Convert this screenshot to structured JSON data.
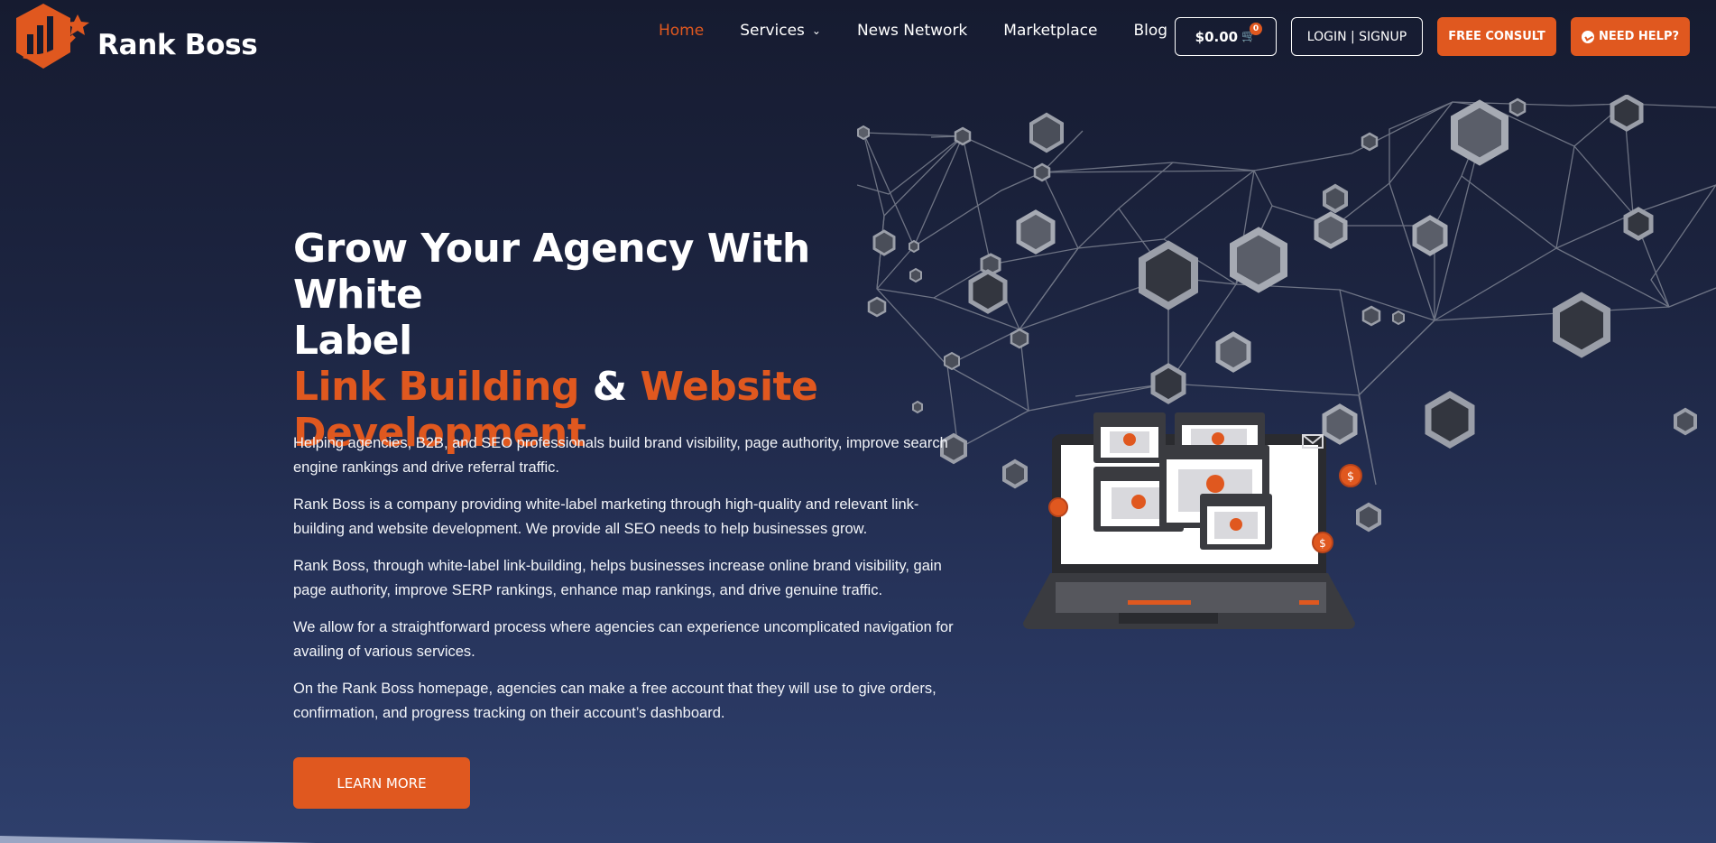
{
  "brand": {
    "name": "Rank Boss"
  },
  "nav": {
    "items": [
      {
        "label": "Home",
        "active": true
      },
      {
        "label": "Services",
        "has_dropdown": true
      },
      {
        "label": "News Network"
      },
      {
        "label": "Marketplace"
      },
      {
        "label": "Blog"
      }
    ]
  },
  "header_actions": {
    "cart_total": "$0.00",
    "cart_count": "0",
    "login_label": "LOGIN | SIGNUP",
    "consult_label": "FREE CONSULT",
    "help_label": "NEED HELP?"
  },
  "hero": {
    "title_line1": "Grow Your Agency With White",
    "title_line2": "Label",
    "highlight1": "Link Building",
    "connector": "&",
    "highlight2": "Website",
    "highlight3": "Development",
    "paragraphs": [
      "Helping agencies, B2B, and SEO professionals build brand visibility, page authority, improve search engine rankings and drive referral traffic.",
      "Rank Boss is a company providing white-label marketing through high-quality and relevant link-building and website development. We provide all SEO needs to help businesses grow.",
      "Rank Boss, through white-label link-building, helps businesses increase online brand visibility, gain page authority, improve SERP rankings, enhance map rankings, and drive genuine traffic.",
      "We allow for a straightforward process where agencies can experience uncomplicated navigation for availing of various services.",
      "On the Rank Boss homepage, agencies can make a free account that they will use to give orders, confirmation, and progress tracking on their account’s dashboard."
    ],
    "cta_label": "LEARN MORE"
  },
  "colors": {
    "accent": "#e0581f",
    "background_top": "#161b30",
    "background_bottom": "#2e3f6c"
  },
  "icons": [
    "rank-boss-logo-icon",
    "chevron-down-icon",
    "cart-icon",
    "messenger-icon",
    "network-illustration",
    "laptop-email-illustration",
    "dollar-coin-icon",
    "envelope-icon"
  ]
}
